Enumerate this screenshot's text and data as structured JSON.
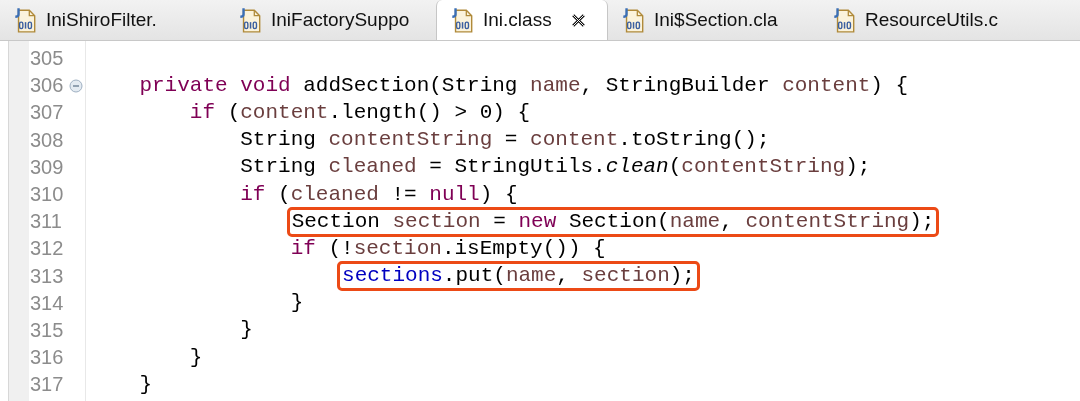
{
  "tabs": [
    {
      "label": "IniShiroFilter.",
      "selected": false
    },
    {
      "label": "IniFactorySuppo",
      "selected": false
    },
    {
      "label": "Ini.class",
      "selected": true
    },
    {
      "label": "Ini$Section.cla",
      "selected": false
    },
    {
      "label": "ResourceUtils.c",
      "selected": false
    }
  ],
  "editor": {
    "lines": [
      {
        "number": "305",
        "foldable": false
      },
      {
        "number": "306",
        "foldable": true,
        "highlighted": false,
        "tokens": [
          {
            "text": "private void ",
            "kind": "keyword"
          },
          {
            "text": "addSection(String ",
            "kind": "plain"
          },
          {
            "text": "name",
            "kind": "local"
          },
          {
            "text": ", StringBuilder ",
            "kind": "plain"
          },
          {
            "text": "content",
            "kind": "local"
          },
          {
            "text": ") {",
            "kind": "plain"
          }
        ],
        "children": [
          {
            "number": "307",
            "foldable": false,
            "highlighted": false,
            "tokens": [
              {
                "text": "if ",
                "kind": "keyword"
              },
              {
                "text": "(",
                "kind": "plain"
              },
              {
                "text": "content",
                "kind": "local"
              },
              {
                "text": ".length() > 0) {",
                "kind": "plain"
              }
            ],
            "children": [
              {
                "number": "308",
                "foldable": false,
                "highlighted": false,
                "tokens": [
                  {
                    "text": "String ",
                    "kind": "plain"
                  },
                  {
                    "text": "contentString",
                    "kind": "local"
                  },
                  {
                    "text": " = ",
                    "kind": "plain"
                  },
                  {
                    "text": "content",
                    "kind": "local"
                  },
                  {
                    "text": ".toString();",
                    "kind": "plain"
                  }
                ]
              },
              {
                "number": "309",
                "foldable": false,
                "highlighted": false,
                "tokens": [
                  {
                    "text": "String ",
                    "kind": "plain"
                  },
                  {
                    "text": "cleaned",
                    "kind": "local"
                  },
                  {
                    "text": " = StringUtils.",
                    "kind": "plain"
                  },
                  {
                    "text": "clean",
                    "kind": "static"
                  },
                  {
                    "text": "(",
                    "kind": "plain"
                  },
                  {
                    "text": "contentString",
                    "kind": "local"
                  },
                  {
                    "text": ");",
                    "kind": "plain"
                  }
                ]
              },
              {
                "number": "310",
                "foldable": false,
                "highlighted": false,
                "tokens": [
                  {
                    "text": "if ",
                    "kind": "keyword"
                  },
                  {
                    "text": "(",
                    "kind": "plain"
                  },
                  {
                    "text": "cleaned",
                    "kind": "local"
                  },
                  {
                    "text": " != ",
                    "kind": "plain"
                  },
                  {
                    "text": "null",
                    "kind": "keyword"
                  },
                  {
                    "text": ") {",
                    "kind": "plain"
                  }
                ],
                "children": [
                  {
                    "number": "311",
                    "foldable": false,
                    "highlighted": true,
                    "tokens": [
                      {
                        "text": "Section ",
                        "kind": "plain"
                      },
                      {
                        "text": "section",
                        "kind": "local"
                      },
                      {
                        "text": " = ",
                        "kind": "plain"
                      },
                      {
                        "text": "new ",
                        "kind": "keyword"
                      },
                      {
                        "text": "Section(",
                        "kind": "plain"
                      },
                      {
                        "text": "name",
                        "kind": "local"
                      },
                      {
                        "text": ", ",
                        "kind": "plain"
                      },
                      {
                        "text": "contentString",
                        "kind": "local"
                      },
                      {
                        "text": ");",
                        "kind": "plain"
                      }
                    ]
                  },
                  {
                    "number": "312",
                    "foldable": false,
                    "highlighted": false,
                    "tokens": [
                      {
                        "text": "if ",
                        "kind": "keyword"
                      },
                      {
                        "text": "(!",
                        "kind": "plain"
                      },
                      {
                        "text": "section",
                        "kind": "local"
                      },
                      {
                        "text": ".isEmpty()) {",
                        "kind": "plain"
                      }
                    ],
                    "children": [
                      {
                        "number": "313",
                        "foldable": false,
                        "highlighted": true,
                        "tokens": [
                          {
                            "text": "sections",
                            "kind": "field"
                          },
                          {
                            "text": ".put(",
                            "kind": "plain"
                          },
                          {
                            "text": "name",
                            "kind": "local"
                          },
                          {
                            "text": ", ",
                            "kind": "plain"
                          },
                          {
                            "text": "section",
                            "kind": "local"
                          },
                          {
                            "text": ");",
                            "kind": "plain"
                          }
                        ]
                      }
                    ]
                  },
                  {
                    "number": "314",
                    "foldable": false,
                    "highlighted": false,
                    "tokens": [
                      {
                        "text": "}",
                        "kind": "plain"
                      }
                    ]
                  }
                ]
              },
              {
                "number": "315",
                "foldable": false,
                "highlighted": false,
                "tokens": [
                  {
                    "text": "}",
                    "kind": "plain"
                  }
                ]
              }
            ]
          },
          {
            "number": "316",
            "foldable": false,
            "highlighted": false,
            "tokens": [
              {
                "text": "}",
                "kind": "plain"
              }
            ]
          }
        ]
      },
      {
        "number": "317",
        "foldable": false,
        "highlighted": false,
        "tokens": [
          {
            "text": "}",
            "kind": "plain"
          }
        ]
      }
    ]
  }
}
